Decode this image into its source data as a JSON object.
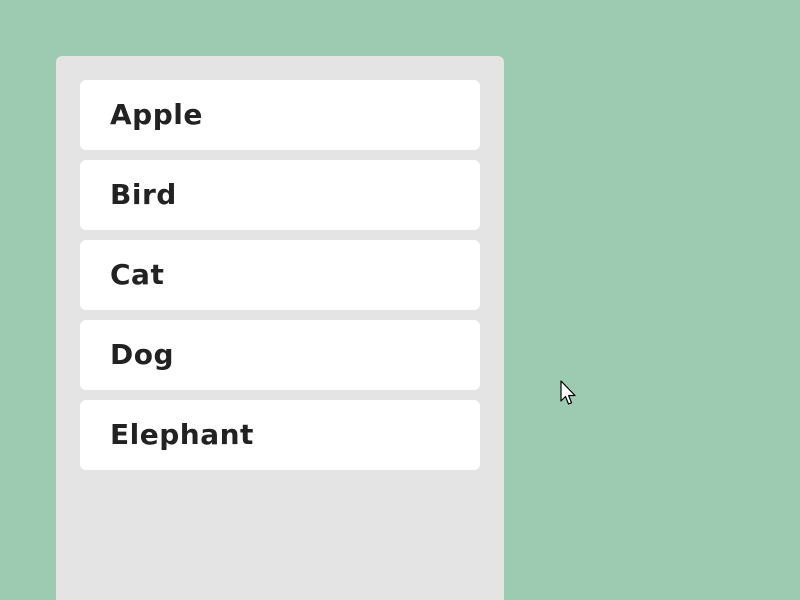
{
  "list": {
    "items": [
      {
        "label": "Apple"
      },
      {
        "label": "Bird"
      },
      {
        "label": "Cat"
      },
      {
        "label": "Dog"
      },
      {
        "label": "Elephant"
      }
    ]
  },
  "colors": {
    "background": "#9ccbb2",
    "panel": "#e4e4e4",
    "item": "#ffffff",
    "text": "#222222"
  },
  "icons": {
    "pointer": "mouse-pointer-icon"
  }
}
